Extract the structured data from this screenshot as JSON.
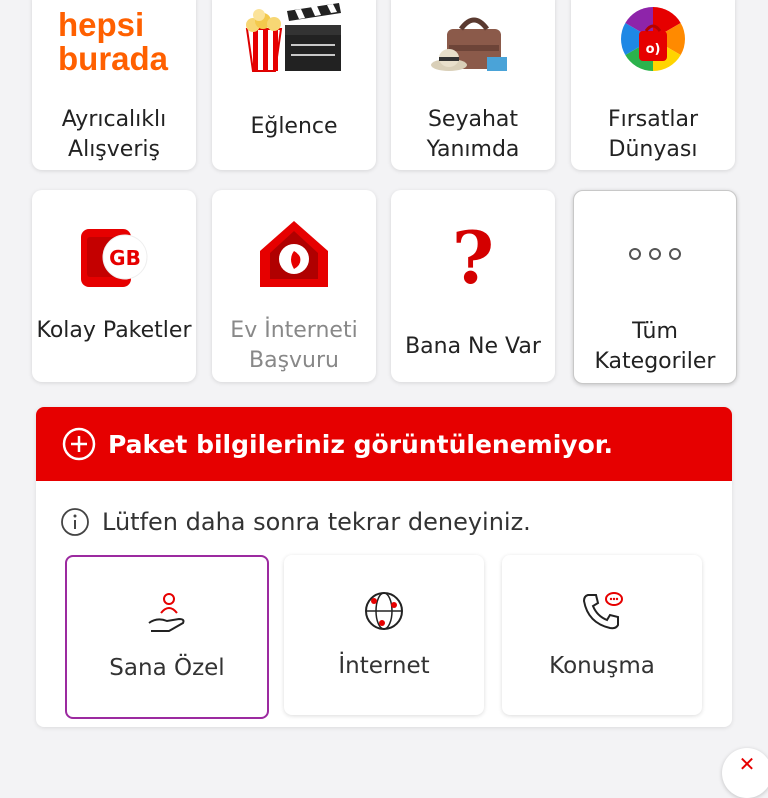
{
  "categories": [
    {
      "label": "Ayrıcalıklı Alışveriş",
      "logo_top": "hepsi",
      "logo_bottom": "burada",
      "icon": "hepsiburada-logo"
    },
    {
      "label": "Eğlence",
      "icon": "popcorn-clapperboard-icon"
    },
    {
      "label": "Seyahat Yanımda",
      "icon": "travel-bag-icon"
    },
    {
      "label": "Fırsatlar Dünyası",
      "icon": "color-wheel-bag-icon"
    },
    {
      "label": "Kolay Paketler",
      "badge": "GB",
      "icon": "gb-phone-icon"
    },
    {
      "label": "Ev İnterneti Başvuru",
      "icon": "vodafone-house-icon",
      "disabled": true
    },
    {
      "label": "Bana Ne Var",
      "icon": "question-mark-icon"
    },
    {
      "label": "Tüm Kategoriler",
      "icon": "more-dots-icon"
    }
  ],
  "alert": {
    "title": "Paket bilgileriniz görüntülenemiyor.",
    "message": "Lütfen daha sonra tekrar deneyiniz."
  },
  "actions": [
    {
      "label": "Sana Özel",
      "icon": "hand-person-icon",
      "selected": true
    },
    {
      "label": "İnternet",
      "icon": "globe-icon"
    },
    {
      "label": "Konuşma",
      "icon": "phone-chat-icon"
    }
  ],
  "colors": {
    "brand_red": "#e60000",
    "selected_border": "#9c2aa0",
    "logo_orange": "#ff6000"
  }
}
